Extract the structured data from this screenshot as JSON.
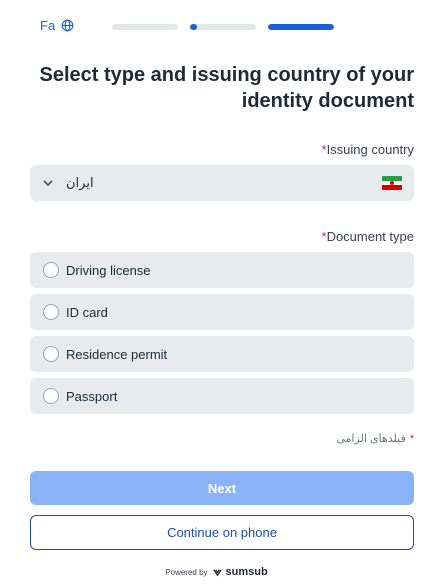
{
  "header": {
    "language_code": "Fa",
    "language_icon": "globe-icon",
    "steps": [
      {
        "progress": 0
      },
      {
        "progress": 0.1
      },
      {
        "progress": 1
      }
    ]
  },
  "title": "Select type and issuing country of your identity document",
  "issuing_country": {
    "label": "Issuing country",
    "required_mark": "*",
    "value": "ایران",
    "flag": "iran-flag-icon"
  },
  "document_type": {
    "label": "Document type",
    "required_mark": "*",
    "options": [
      {
        "label": "Driving license"
      },
      {
        "label": "ID card"
      },
      {
        "label": "Residence permit"
      },
      {
        "label": "Passport"
      }
    ]
  },
  "required_note": {
    "mark": "*",
    "text": "فیلدهای الزامی"
  },
  "buttons": {
    "next": "Next",
    "continue_on_phone": "Continue on phone"
  },
  "footer": {
    "powered_by": "Powered by",
    "brand": "sumsub"
  },
  "colors": {
    "accent": "#1d5fd6",
    "required": "#e11d48",
    "disabled_button": "#8ab3f7"
  }
}
